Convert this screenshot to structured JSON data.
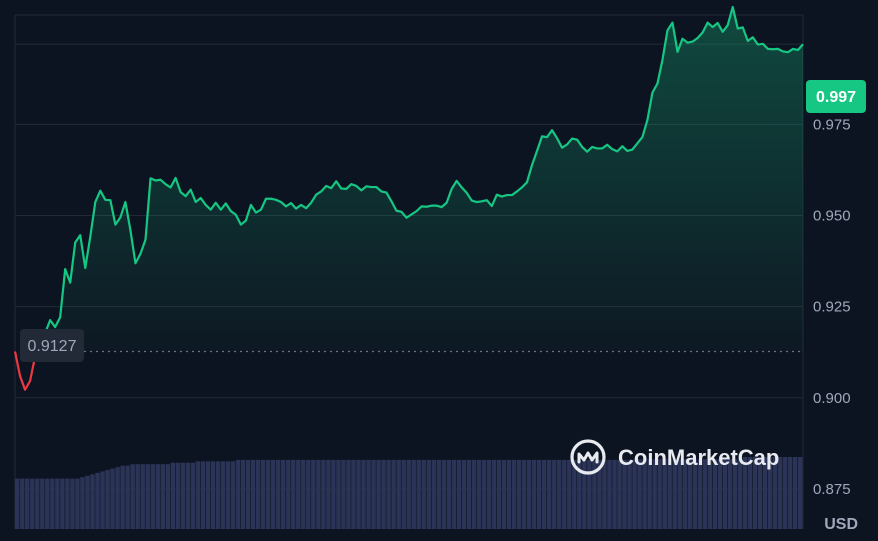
{
  "colors": {
    "background": "#0d1421",
    "grid": "#222a38",
    "up": "#16c784",
    "down": "#ea3943",
    "volume": "#2b3456",
    "tick": "#a1a7bb"
  },
  "brand": {
    "name": "CoinMarketCap",
    "logo_icon": "coinmarketcap-logo-icon"
  },
  "price_tag": {
    "label": "0.997"
  },
  "open_tag": {
    "label": "0.9127"
  },
  "axis": {
    "unit": "USD"
  },
  "chart_data": {
    "type": "area",
    "y_axis_position": "right",
    "ylim": [
      0.864,
      1.005
    ],
    "yticks": [
      0.875,
      0.9,
      0.925,
      0.95,
      0.975,
      0.997
    ],
    "ytick_labels": [
      "0.875",
      "0.900",
      "0.925",
      "0.950",
      "0.975",
      "0.997"
    ],
    "reference_line": {
      "value": 0.9127,
      "style": "dotted"
    },
    "last_value": 0.997,
    "series": [
      {
        "values": [
          0.9127,
          0.906,
          0.9022,
          0.9046,
          0.9113,
          0.9137,
          0.9177,
          0.9213,
          0.9194,
          0.9221,
          0.9353,
          0.9316,
          0.9426,
          0.9446,
          0.9356,
          0.9442,
          0.9537,
          0.9568,
          0.9543,
          0.9542,
          0.9475,
          0.9495,
          0.9537,
          0.9459,
          0.9369,
          0.9395,
          0.9434,
          0.9602,
          0.9596,
          0.9598,
          0.9586,
          0.9577,
          0.9603,
          0.9564,
          0.9553,
          0.9571,
          0.9537,
          0.9548,
          0.9529,
          0.9516,
          0.9535,
          0.9516,
          0.9533,
          0.9512,
          0.9502,
          0.9475,
          0.9486,
          0.9529,
          0.9508,
          0.9516,
          0.9546,
          0.9546,
          0.9543,
          0.9537,
          0.9525,
          0.9534,
          0.9519,
          0.9529,
          0.952,
          0.9535,
          0.9557,
          0.9566,
          0.9581,
          0.9575,
          0.9594,
          0.9574,
          0.9573,
          0.9586,
          0.9581,
          0.9569,
          0.958,
          0.9578,
          0.9578,
          0.9566,
          0.9563,
          0.9539,
          0.9513,
          0.951,
          0.9494,
          0.9503,
          0.9512,
          0.9525,
          0.9524,
          0.9527,
          0.9527,
          0.9523,
          0.9535,
          0.9573,
          0.9595,
          0.9577,
          0.9562,
          0.9541,
          0.9537,
          0.9539,
          0.9542,
          0.9526,
          0.9557,
          0.9552,
          0.9556,
          0.9556,
          0.9566,
          0.9577,
          0.9591,
          0.9638,
          0.9677,
          0.9717,
          0.9715,
          0.9734,
          0.9712,
          0.9686,
          0.9695,
          0.9711,
          0.9708,
          0.9688,
          0.9675,
          0.9688,
          0.9684,
          0.9684,
          0.9694,
          0.9682,
          0.9676,
          0.969,
          0.9677,
          0.9681,
          0.9698,
          0.9715,
          0.9762,
          0.9837,
          0.9862,
          0.9927,
          1.0008,
          1.0029,
          0.9949,
          0.9985,
          0.9974,
          0.9977,
          0.9987,
          1.0002,
          1.0029,
          1.0017,
          1.0028,
          1.0004,
          1.0022,
          1.0072,
          1.0013,
          1.0016,
          0.9979,
          0.9989,
          0.9969,
          0.9971,
          0.9957,
          0.9956,
          0.9957,
          0.995,
          0.9948,
          0.9957,
          0.9954,
          0.997
        ]
      }
    ],
    "volume": [
      0.7,
      0.7,
      0.7,
      0.7,
      0.7,
      0.7,
      0.7,
      0.7,
      0.7,
      0.7,
      0.7,
      0.7,
      0.7,
      0.72,
      0.74,
      0.76,
      0.78,
      0.8,
      0.82,
      0.84,
      0.86,
      0.88,
      0.88,
      0.9,
      0.9,
      0.9,
      0.9,
      0.9,
      0.9,
      0.9,
      0.9,
      0.92,
      0.92,
      0.92,
      0.92,
      0.92,
      0.94,
      0.94,
      0.94,
      0.94,
      0.94,
      0.94,
      0.94,
      0.94,
      0.96,
      0.96,
      0.96,
      0.96,
      0.96,
      0.96,
      0.96,
      0.96,
      0.96,
      0.96,
      0.96,
      0.96,
      0.96,
      0.96,
      0.96,
      0.96,
      0.96,
      0.96,
      0.96,
      0.96,
      0.96,
      0.96,
      0.96,
      0.96,
      0.96,
      0.96,
      0.96,
      0.96,
      0.96,
      0.96,
      0.96,
      0.96,
      0.96,
      0.96,
      0.96,
      0.96,
      0.96,
      0.96,
      0.96,
      0.96,
      0.96,
      0.96,
      0.96,
      0.96,
      0.96,
      0.96,
      0.96,
      0.96,
      0.96,
      0.96,
      0.96,
      0.96,
      0.96,
      0.96,
      0.96,
      0.96,
      0.96,
      0.96,
      0.96,
      0.96,
      0.96,
      0.96,
      0.96,
      0.96,
      0.96,
      0.96,
      0.96,
      0.96,
      0.96,
      0.96,
      0.96,
      0.96,
      0.96,
      0.96,
      0.96,
      0.96,
      0.96,
      0.96,
      0.96,
      0.96,
      0.97,
      0.97,
      0.97,
      0.97,
      0.97,
      0.97,
      0.97,
      0.97,
      0.97,
      0.97,
      0.97,
      0.97,
      0.97,
      0.97,
      0.97,
      0.97,
      0.97,
      0.97,
      0.97,
      0.97,
      0.97,
      1,
      1,
      1,
      1,
      1,
      1,
      1,
      1,
      1,
      1,
      1,
      1
    ]
  }
}
